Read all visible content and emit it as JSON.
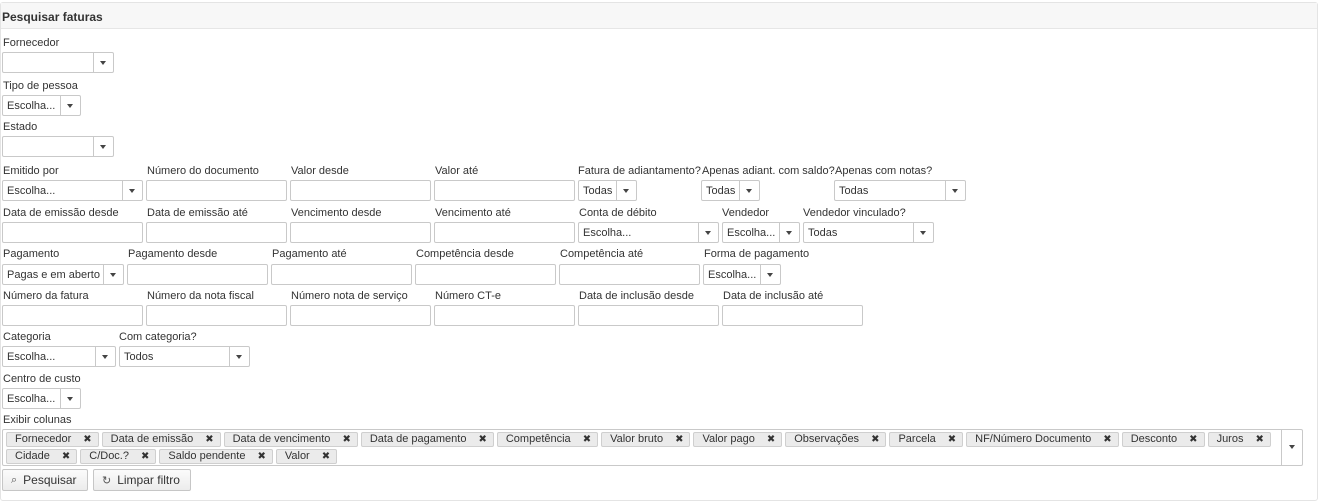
{
  "panel": {
    "title": "Pesquisar faturas"
  },
  "fields": {
    "fornecedor": {
      "label": "Fornecedor",
      "value": ""
    },
    "tipo_pessoa": {
      "label": "Tipo de pessoa",
      "value": "Escolha..."
    },
    "estado": {
      "label": "Estado",
      "value": ""
    },
    "emitido_por": {
      "label": "Emitido por",
      "value": "Escolha..."
    },
    "numero_documento": {
      "label": "Número do documento",
      "value": ""
    },
    "valor_desde": {
      "label": "Valor desde",
      "value": ""
    },
    "valor_ate": {
      "label": "Valor até",
      "value": ""
    },
    "fatura_adiantamento": {
      "label": "Fatura de adiantamento?",
      "value": "Todas"
    },
    "apenas_adiant_saldo": {
      "label": "Apenas adiant. com saldo?",
      "value": "Todas"
    },
    "apenas_com_notas": {
      "label": "Apenas com notas?",
      "value": "Todas"
    },
    "data_emissao_desde": {
      "label": "Data de emissão desde",
      "value": ""
    },
    "data_emissao_ate": {
      "label": "Data de emissão até",
      "value": ""
    },
    "vencimento_desde": {
      "label": "Vencimento desde",
      "value": ""
    },
    "vencimento_ate": {
      "label": "Vencimento até",
      "value": ""
    },
    "conta_debito": {
      "label": "Conta de débito",
      "value": "Escolha..."
    },
    "vendedor": {
      "label": "Vendedor",
      "value": "Escolha..."
    },
    "vendedor_vinculado": {
      "label": "Vendedor vinculado?",
      "value": "Todas"
    },
    "pagamento": {
      "label": "Pagamento",
      "value": "Pagas e em aberto"
    },
    "pagamento_desde": {
      "label": "Pagamento desde",
      "value": ""
    },
    "pagamento_ate": {
      "label": "Pagamento até",
      "value": ""
    },
    "competencia_desde": {
      "label": "Competência desde",
      "value": ""
    },
    "competencia_ate": {
      "label": "Competência até",
      "value": ""
    },
    "forma_pagamento": {
      "label": "Forma de pagamento",
      "value": "Escolha..."
    },
    "numero_fatura": {
      "label": "Número da fatura",
      "value": ""
    },
    "numero_nota_fiscal": {
      "label": "Número da nota fiscal",
      "value": ""
    },
    "numero_nota_servico": {
      "label": "Número nota de serviço",
      "value": ""
    },
    "numero_cte": {
      "label": "Número CT-e",
      "value": ""
    },
    "data_inclusao_desde": {
      "label": "Data de inclusão desde",
      "value": ""
    },
    "data_inclusao_ate": {
      "label": "Data de inclusão até",
      "value": ""
    },
    "categoria": {
      "label": "Categoria",
      "value": "Escolha..."
    },
    "com_categoria": {
      "label": "Com categoria?",
      "value": "Todos"
    },
    "centro_custo": {
      "label": "Centro de custo",
      "value": "Escolha..."
    }
  },
  "columns": {
    "label": "Exibir colunas",
    "tags": [
      "Fornecedor",
      "Data de emissão",
      "Data de vencimento",
      "Data de pagamento",
      "Competência",
      "Valor bruto",
      "Valor pago",
      "Observações",
      "Parcela",
      "NF/Número Documento",
      "Desconto",
      "Juros",
      "Cidade",
      "C/Doc.?",
      "Saldo pendente",
      "Valor"
    ],
    "remove_glyph": "✖"
  },
  "buttons": {
    "search": {
      "label": "Pesquisar",
      "icon": "search-icon"
    },
    "clear": {
      "label": "Limpar filtro",
      "icon": "refresh-icon"
    }
  }
}
